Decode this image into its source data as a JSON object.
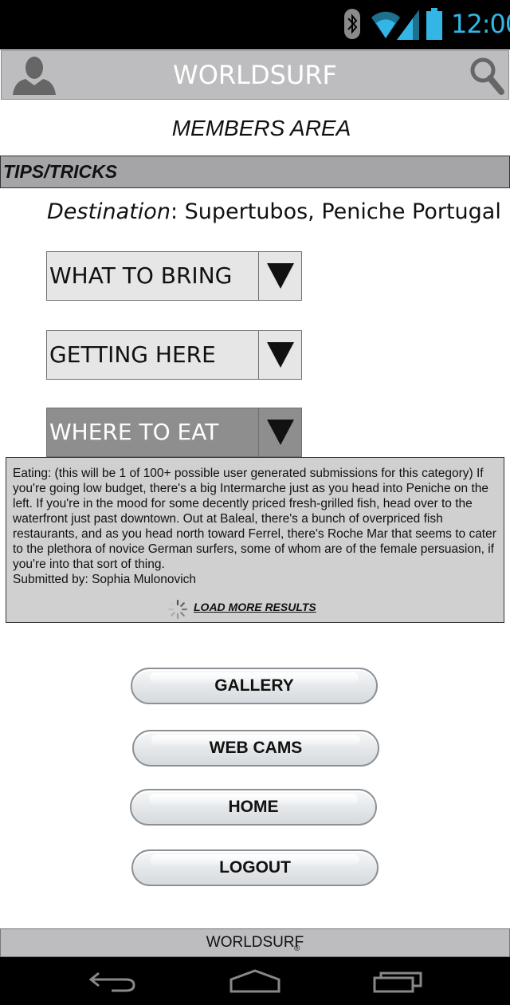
{
  "status_bar": {
    "time": "12:00",
    "icons": [
      "bluetooth-icon",
      "wifi-icon",
      "signal-icon",
      "battery-icon"
    ],
    "accent_color": "#33b5e5"
  },
  "header": {
    "title": "WORLDSURF",
    "left_icon": "profile-icon",
    "right_icon": "search-icon"
  },
  "page_title": "MEMBERS AREA",
  "section": {
    "title": "TIPS/TRICKS"
  },
  "destination": {
    "label": "Destination",
    "separator": ": ",
    "value": "Supertubos, Peniche Portugal"
  },
  "dropdowns": [
    {
      "label": "WHAT TO BRING",
      "expanded": false
    },
    {
      "label": "GETTING HERE",
      "expanded": false
    },
    {
      "label": "WHERE TO EAT",
      "expanded": true
    }
  ],
  "eat_panel": {
    "text": "Eating: (this will be 1 of 100+ possible user generated submissions for this category) If you're going low budget, there's a big Intermarche just as you head into Peniche on the left. If you're in the mood for some decently priced fresh-grilled fish, head over to the waterfront just past downtown. Out at Baleal, there's a bunch of overpriced fish restaurants, and as you head north toward Ferrel, there's Roche Mar that seems to cater to the plethora of novice German surfers, some of whom are of the female persuasion, if you're into that sort of thing.",
    "submitted_by": "Submitted by: Sophia Mulonovich",
    "load_more": "LOAD MORE RESULTS"
  },
  "buttons": {
    "gallery": "GALLERY",
    "web_cams": "WEB CAMS",
    "home": "HOME",
    "logout": "LOGOUT"
  },
  "footer": {
    "text": "WORLDSURF",
    "mark": "®"
  },
  "nav": {
    "icons": [
      "back-icon",
      "home-nav-icon",
      "recent-apps-icon"
    ]
  }
}
